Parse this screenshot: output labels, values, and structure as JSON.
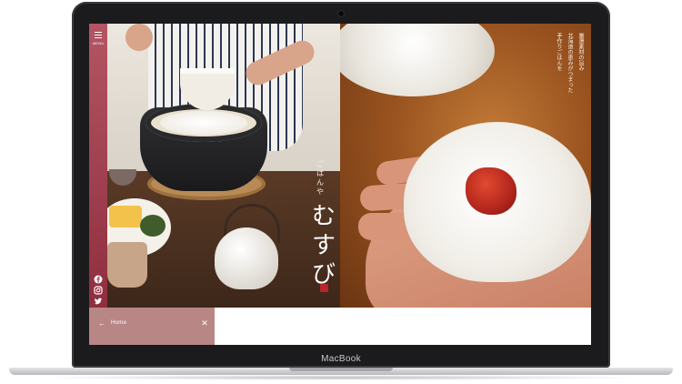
{
  "device": {
    "brand_label": "MacBook"
  },
  "site": {
    "menu_label": "MENU",
    "brand_subtitle": "ごはんや",
    "brand_title": "むすび",
    "copy_lines": [
      "厳選素材の旨み",
      "北海道の恵みがつまった",
      "手作りごはんを"
    ]
  },
  "social": [
    {
      "name": "facebook",
      "icon": "facebook-icon"
    },
    {
      "name": "instagram",
      "icon": "instagram-icon"
    },
    {
      "name": "twitter",
      "icon": "twitter-icon"
    }
  ],
  "bottom_panel": {
    "back_label": "Home",
    "back_icon": "arrow-left-icon",
    "close_icon": "close-icon"
  },
  "colors": {
    "accent": "#9c3a48",
    "panel": "#b98686",
    "seal": "#b6262c"
  }
}
